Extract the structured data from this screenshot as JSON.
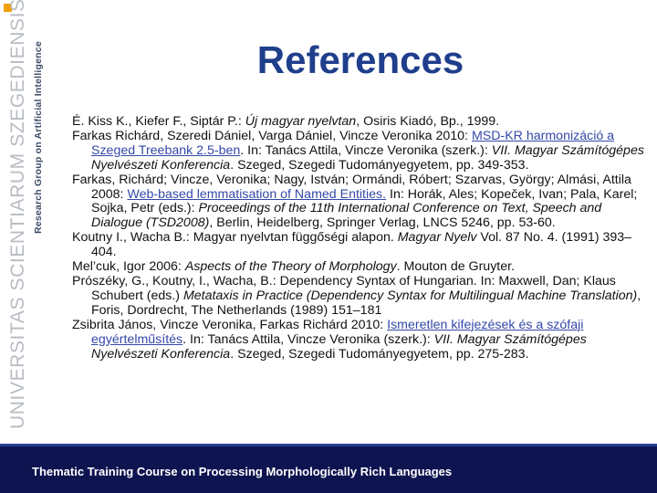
{
  "slide": {
    "title": "References",
    "side_labels": {
      "research_group": "Research Group on Artificial Intelligence",
      "university": "UNIVERSITAS SCIENTIARUM SZEGEDIENSIS"
    },
    "footer": "Thematic Training Course on Processing Morphologically Rich Languages",
    "colors": {
      "title": "#1f3e8c",
      "footer_bg": "#0e1450",
      "link": "#3348a8",
      "corner_accent": "#f0a000"
    }
  },
  "references": [
    {
      "pre": "É. Kiss K., Kiefer F., Siptár P.: ",
      "italic": "Új magyar nyelvtan",
      "post": ", Osiris Kiadó, Bp., 1999."
    },
    {
      "pre": "Farkas Richárd, Szeredi Dániel, Varga Dániel, Vincze Veronika 2010: ",
      "link": "MSD-KR harmonizáció a Szeged Treebank 2.5-ben",
      "mid": ". In: Tanács Attila, Vincze Veronika (szerk.): ",
      "italic": "VII. Magyar Számítógépes Nyelvészeti Konferencia",
      "post": ". Szeged, Szegedi Tudományegyetem, pp. 349-353."
    },
    {
      "pre": "Farkas, Richárd; Vincze, Veronika; Nagy, István; Ormándi, Róbert; Szarvas, György; Almási, Attila 2008: ",
      "link": "Web-based lemmatisation of Named Entities.",
      "mid": " In: Horák, Ales; Kopeček, Ivan; Pala, Karel; Sojka, Petr (eds.): ",
      "italic": "Proceedings of the 11th International Conference on Text, Speech and Dialogue (TSD2008)",
      "post": ", Berlin, Heidelberg, Springer Verlag, LNCS 5246, pp. 53-60."
    },
    {
      "pre": "Koutny I., Wacha B.: Magyar nyelvtan függőségi alapon. ",
      "italic": "Magyar Nyelv",
      "post": " Vol. 87 No. 4. (1991) 393–404."
    },
    {
      "pre": "Mel’cuk, Igor 2006: ",
      "italic": "Aspects of the Theory of Morphology",
      "post": ". Mouton de Gruyter."
    },
    {
      "pre": "Prószéky, G., Koutny, I., Wacha, B.: Dependency Syntax of Hungarian. In: Maxwell, Dan; Klaus Schubert (eds.) ",
      "italic": "Metataxis in Practice (Dependency Syntax for Multilingual Machine Translation)",
      "post": ", Foris, Dordrecht, The Netherlands (1989) 151–181"
    },
    {
      "pre": "Zsibrita János, Vincze Veronika, Farkas Richárd 2010: ",
      "link": "Ismeretlen kifejezések és a szófaji egyértelműsítés",
      "mid": ". In: Tanács Attila, Vincze Veronika (szerk.): ",
      "italic": "VII. Magyar Számítógépes Nyelvészeti Konferencia",
      "post": ". Szeged, Szegedi Tudományegyetem, pp. 275-283."
    }
  ]
}
